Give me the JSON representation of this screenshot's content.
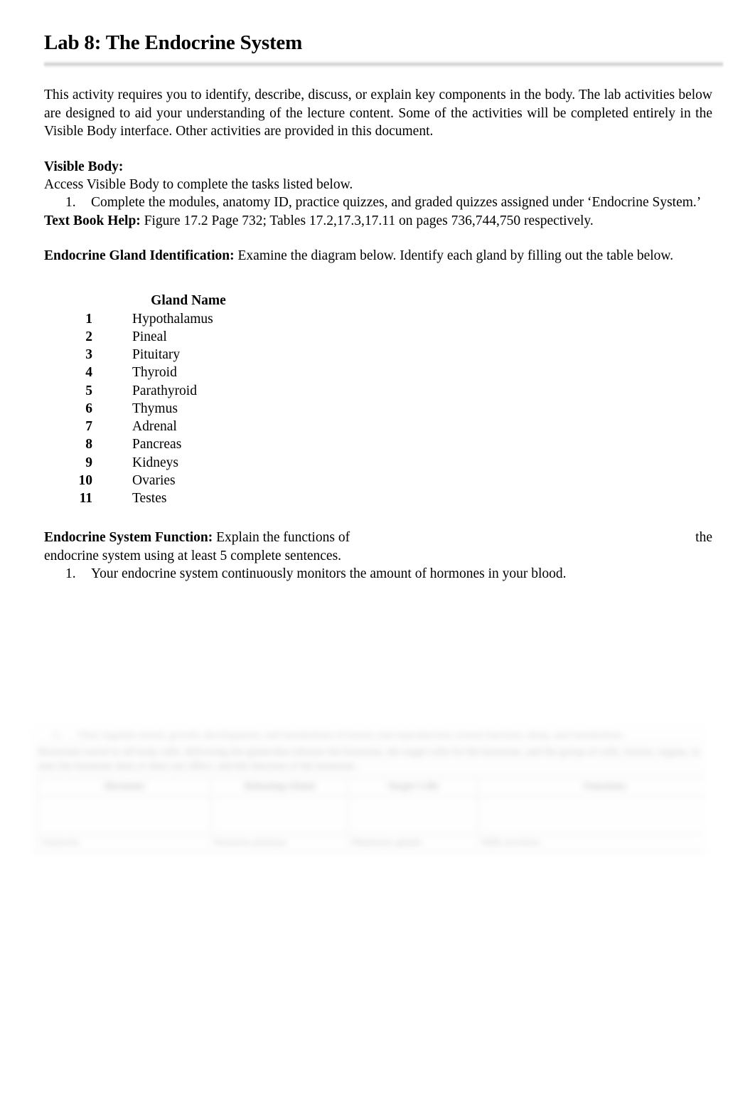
{
  "document": {
    "title": "Lab 8: The Endocrine System",
    "intro_paragraph": "This activity requires you to identify, describe, discuss, or explain key components in the body. The lab activities below are designed to aid your understanding of the lecture content. Some of the activities will be completed entirely in the Visible Body interface. Other activities are provided in this document."
  },
  "visible_body": {
    "heading": "Visible Body:",
    "instruction": "Access Visible Body to complete the tasks listed below.",
    "items": [
      {
        "marker": "1.",
        "text": "Complete the modules, anatomy ID, practice quizzes, and graded quizzes assigned under ‘Endocrine System.’"
      }
    ]
  },
  "textbook_help": {
    "label": "Text Book Help:",
    "text": " Figure 17.2 Page 732; Tables 17.2,17.3,17.11 on pages 736,744,750 respectively."
  },
  "gland_identification": {
    "label": "Endocrine Gland Identification:",
    "text": " Examine the diagram below. Identify each gland by filling out the table below.",
    "column_header": "Gland Name",
    "rows": [
      {
        "number": "1",
        "gland": "Hypothalamus"
      },
      {
        "number": "2",
        "gland": "Pineal"
      },
      {
        "number": "3",
        "gland": "Pituitary"
      },
      {
        "number": "4",
        "gland": "Thyroid"
      },
      {
        "number": "5",
        "gland": "Parathyroid"
      },
      {
        "number": "6",
        "gland": "Thymus"
      },
      {
        "number": "7",
        "gland": "Adrenal"
      },
      {
        "number": "8",
        "gland": "Pancreas"
      },
      {
        "number": "9",
        "gland": "Kidneys"
      },
      {
        "number": "10",
        "gland": "Ovaries"
      },
      {
        "number": "11",
        "gland": "Testes"
      }
    ]
  },
  "system_function": {
    "label": "Endocrine System Function:",
    "line1_left": " Explain the functions of",
    "line1_right": "the",
    "line2": "endocrine system using at least 5 complete sentences.",
    "items": [
      {
        "marker": "1.",
        "text": "Your endocrine system continuously monitors the amount of hormones in your blood."
      }
    ]
  },
  "faded_preview": {
    "visible": true,
    "note": "blurred-unreadable-page-continuation",
    "list_items": [
      {
        "marker": "2.",
        "text": "They regulate mood, growth, development, and metabolism of tissues and reproduction, sexual function, sleep, and metabolism."
      }
    ],
    "paragraph": "Hormones travel to all body cells, delivering the gland that releases the hormone, the target cells for the hormone, and the group of cells, tissues, organs, or sites the hormone does or does not affect, and the function of the hormone.",
    "table": {
      "headers": [
        "Hormone",
        "Releasing Gland",
        "Target Cells",
        "Functions"
      ],
      "rows": [
        [
          "Oxytocin",
          "Posterior pituitary",
          "Mammary glands",
          "Milk secretion"
        ]
      ],
      "blank_row_count": 1
    }
  }
}
